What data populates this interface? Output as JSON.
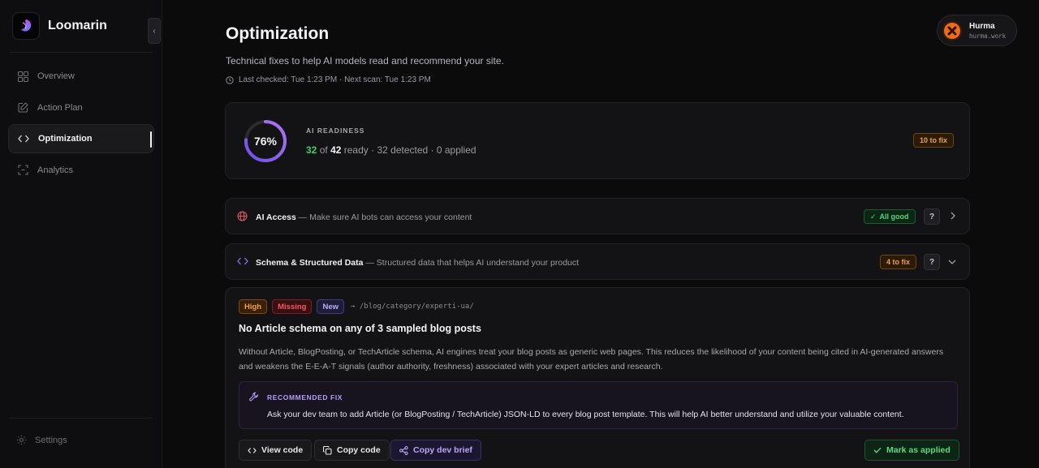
{
  "app": {
    "name": "Loomarin"
  },
  "sidebar": {
    "collapse_icon": "‹",
    "items": [
      {
        "label": "Overview",
        "icon": "grid-icon"
      },
      {
        "label": "Action Plan",
        "icon": "edit-icon"
      },
      {
        "label": "Optimization",
        "icon": "code-icon",
        "active": true
      },
      {
        "label": "Analytics",
        "icon": "analytics-icon"
      }
    ],
    "settings_label": "Settings"
  },
  "header": {
    "title": "Optimization",
    "subtitle": "Technical fixes to help AI models read and recommend your site.",
    "last_checked": "Last checked: Tue 1:23 PM · Next scan: Tue 1:23 PM"
  },
  "user": {
    "name": "Hurma",
    "domain": "hurma.work"
  },
  "readiness": {
    "percent": 76,
    "percent_label": "76%",
    "title": "AI READINESS",
    "ready_count": "32",
    "of_text": "of",
    "total": "42",
    "ready_text": "ready",
    "details": "· 32 detected · 0 applied",
    "fix_badge": "10 to fix"
  },
  "sections": [
    {
      "title": "AI Access",
      "description": "— Make sure AI bots can access your content",
      "status": "All good",
      "help": "?"
    },
    {
      "title": "Schema & Structured Data",
      "description": "— Structured data that helps AI understand your product",
      "status": "4 to fix",
      "help": "?"
    }
  ],
  "issue": {
    "tags": [
      "High",
      "Missing",
      "New"
    ],
    "path": "→ /blog/category/experti-ua/",
    "title": "No Article schema on any of 3 sampled blog posts",
    "description": "Without Article, BlogPosting, or TechArticle schema, AI engines treat your blog posts as generic web pages. This reduces the likelihood of your content being cited in AI-generated answers and weakens the E-E-A-T signals (author authority, freshness) associated with your expert articles and research.",
    "fix_title": "RECOMMENDED FIX",
    "fix_text": "Ask your dev team to add Article (or BlogPosting / TechArticle) JSON-LD to every blog post template. This will help AI better understand and utilize your valuable content.",
    "buttons": {
      "view_code": "View code",
      "copy_code": "Copy code",
      "copy_brief": "Copy dev brief",
      "mark_applied": "Mark as applied"
    }
  },
  "colors": {
    "accent_purple": "#9b6cf0",
    "ok_green": "#3fcf6a",
    "warn_orange": "#f0a23a",
    "danger_red": "#f05a63"
  }
}
